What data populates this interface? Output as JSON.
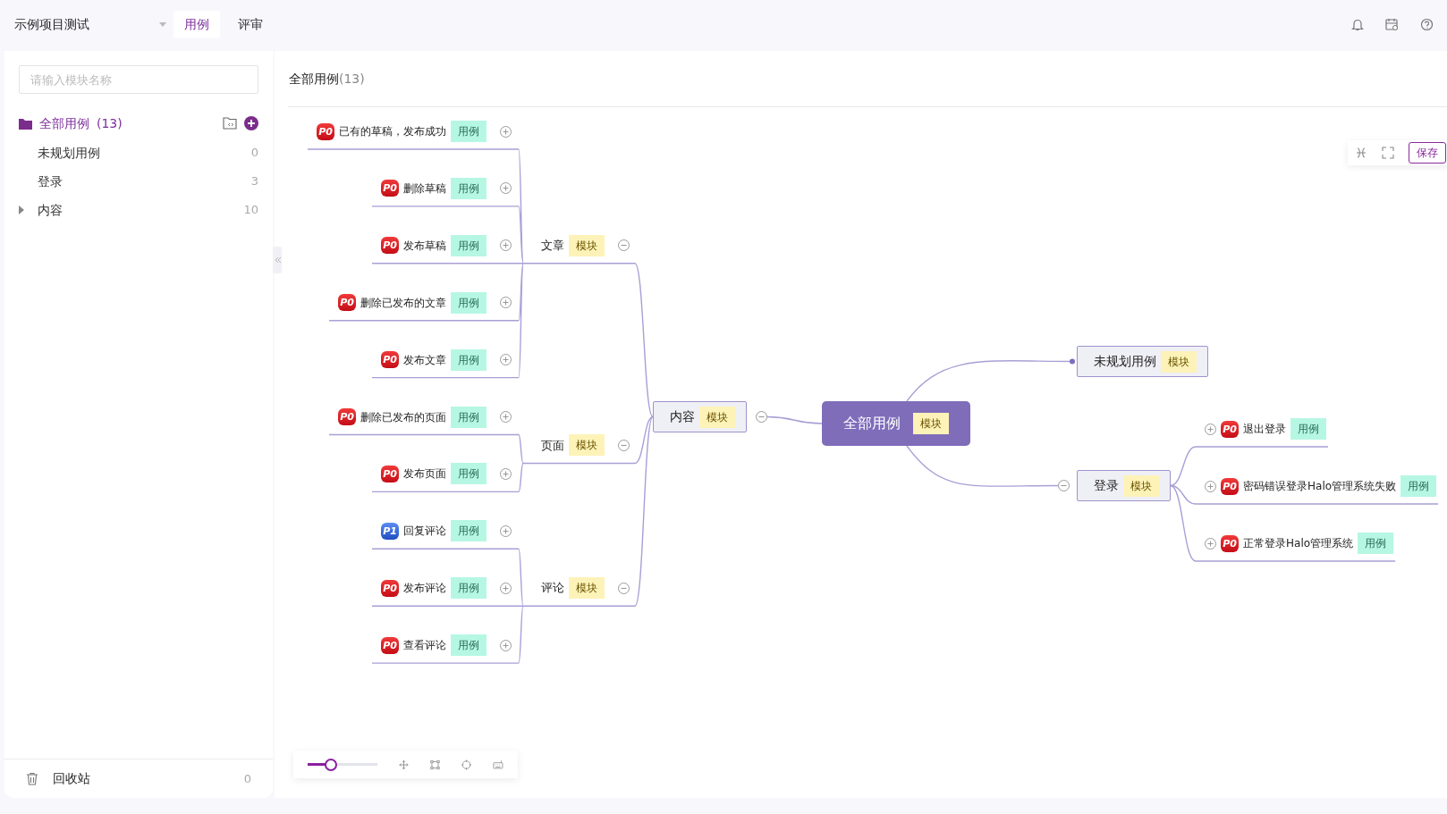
{
  "header": {
    "project": "示例项目测试",
    "tabs": [
      {
        "label": "用例",
        "selected": true
      },
      {
        "label": "评审",
        "selected": false
      }
    ]
  },
  "sidebar": {
    "search": {
      "placeholder": "请输入模块名称"
    },
    "root": {
      "label": "全部用例",
      "count": "(13)",
      "selected": true
    },
    "items": [
      {
        "label": "未规划用例",
        "count": "0",
        "kind": "leaf",
        "selected": false
      },
      {
        "label": "登录",
        "count": "3",
        "kind": "leaf",
        "selected": false
      },
      {
        "label": "内容",
        "count": "10",
        "kind": "group",
        "selected": false
      }
    ],
    "recycle": {
      "label": "回收站",
      "count": "0"
    }
  },
  "main": {
    "title": "全部用例",
    "count": "(13)",
    "save_button": "保存"
  },
  "mindmap": {
    "root": {
      "label": "全部用例",
      "tag": "模块",
      "children": [
        {
          "label": "内容",
          "tag": "模块",
          "expanded": true,
          "children": [
            {
              "label": "文章",
              "tag": "模块",
              "expanded": true,
              "children": [
                {
                  "label": "已有的草稿，发布成功",
                  "tag": "用例",
                  "priority": "P0",
                  "expanded": false
                },
                {
                  "label": "删除草稿",
                  "tag": "用例",
                  "priority": "P0",
                  "expanded": false
                },
                {
                  "label": "发布草稿",
                  "tag": "用例",
                  "priority": "P0",
                  "expanded": false
                },
                {
                  "label": "删除已发布的文章",
                  "tag": "用例",
                  "priority": "P0",
                  "expanded": false
                },
                {
                  "label": "发布文章",
                  "tag": "用例",
                  "priority": "P0",
                  "expanded": false
                }
              ]
            },
            {
              "label": "页面",
              "tag": "模块",
              "expanded": true,
              "children": [
                {
                  "label": "删除已发布的页面",
                  "tag": "用例",
                  "priority": "P0",
                  "expanded": false
                },
                {
                  "label": "发布页面",
                  "tag": "用例",
                  "priority": "P0",
                  "expanded": false
                }
              ]
            },
            {
              "label": "评论",
              "tag": "模块",
              "expanded": true,
              "children": [
                {
                  "label": "回复评论",
                  "tag": "用例",
                  "priority": "P1",
                  "expanded": false
                },
                {
                  "label": "发布评论",
                  "tag": "用例",
                  "priority": "P0",
                  "expanded": false
                },
                {
                  "label": "查看评论",
                  "tag": "用例",
                  "priority": "P0",
                  "expanded": false
                }
              ]
            }
          ]
        },
        {
          "label": "未规划用例",
          "tag": "模块"
        },
        {
          "label": "登录",
          "tag": "模块",
          "expanded": true,
          "children": [
            {
              "label": "退出登录",
              "tag": "用例",
              "priority": "P0",
              "expanded": false
            },
            {
              "label": "密码错误登录Halo管理系统失败",
              "tag": "用例",
              "priority": "P0",
              "expanded": false
            },
            {
              "label": "正常登录Halo管理系统",
              "tag": "用例",
              "priority": "P0",
              "expanded": false
            }
          ]
        }
      ]
    }
  },
  "zoom": {
    "level": 0.33
  }
}
